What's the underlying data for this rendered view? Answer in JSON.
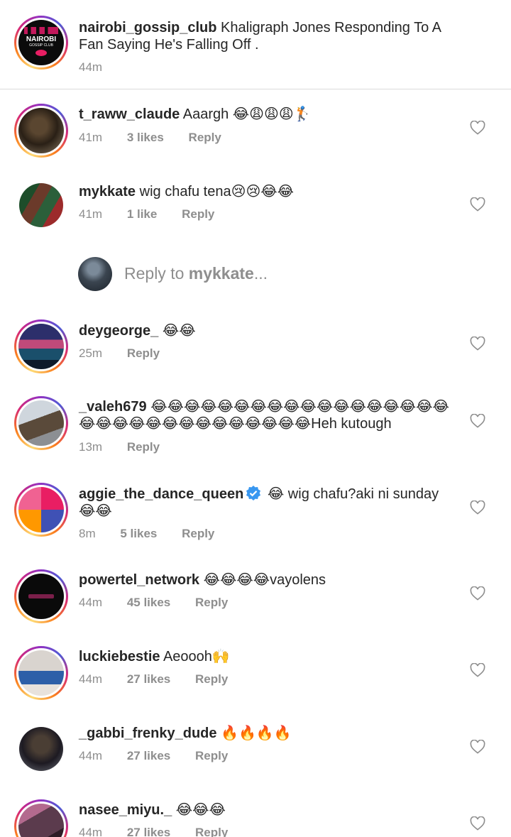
{
  "caption": {
    "username": "nairobi_gossip_club",
    "text": "Khaligraph Jones Responding To A Fan Saying He's Falling Off .",
    "time": "44m",
    "avatar_logo_line1": "NAIROBI",
    "avatar_logo_line2": "GOSSIP CLUB"
  },
  "comments": [
    {
      "username": "t_raww_claude",
      "text": "Aaargh 😂😩😩😩🏌️",
      "time": "41m",
      "likes": "3 likes",
      "reply": "Reply"
    },
    {
      "username": "mykkate",
      "text": "wig chafu tena😢😢😂😂",
      "time": "41m",
      "likes": "1 like",
      "reply": "Reply"
    },
    {
      "username": "deygeorge_",
      "text": "😂😂",
      "time": "25m",
      "likes": "",
      "reply": "Reply"
    },
    {
      "username": "_valeh679",
      "text": "😂😂😂😂😂😂😂😂😂😂😂😂😂😂😂😂😂😂😂😂😂😂😂😂😂😂😂😂😂😂😂😂Heh kutough",
      "time": "13m",
      "likes": "",
      "reply": "Reply"
    },
    {
      "username": "aggie_the_dance_queen",
      "text": "😂 wig chafu?aki ni sunday😂😂",
      "time": "8m",
      "likes": "5 likes",
      "reply": "Reply"
    },
    {
      "username": "powertel_network",
      "text": "😂😂😂😂vayolens",
      "time": "44m",
      "likes": "45 likes",
      "reply": "Reply"
    },
    {
      "username": "luckiebestie",
      "text": "Aeoooh🙌",
      "time": "44m",
      "likes": "27 likes",
      "reply": "Reply"
    },
    {
      "username": "_gabbi_frenky_dude",
      "text": "🔥🔥🔥🔥",
      "time": "44m",
      "likes": "27 likes",
      "reply": "Reply"
    },
    {
      "username": "nasee_miyu._",
      "text": "😂😂😂",
      "time": "44m",
      "likes": "27 likes",
      "reply": "Reply"
    }
  ],
  "reply_to": {
    "prefix": "Reply to ",
    "username": "mykkate",
    "suffix": "..."
  },
  "colors": {
    "text": "#262626",
    "secondary": "#8e8e8e",
    "verified": "#3897f0",
    "divider": "#dbdbdb"
  },
  "icons": {
    "like": "heart-outline-icon",
    "verified": "verified-badge-icon"
  }
}
